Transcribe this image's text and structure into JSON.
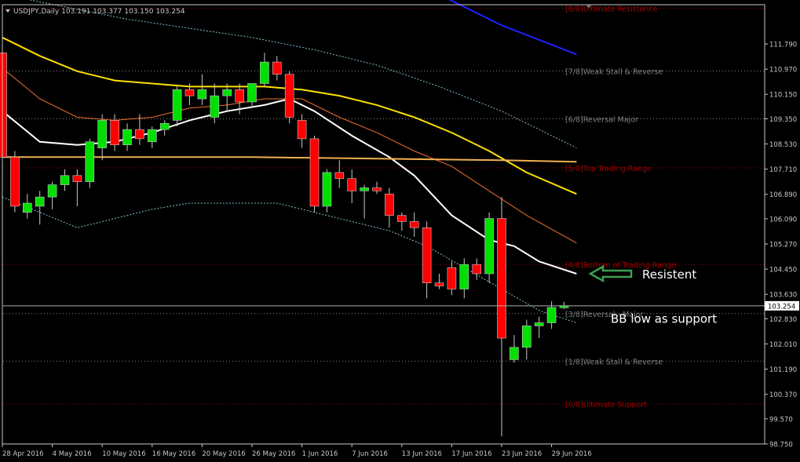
{
  "header": {
    "symbol_line": "USDJPY,Daily  103.191 103.377 103.150 103.254"
  },
  "colors": {
    "background": "#000000",
    "axis": "#c8c8c8",
    "bull": "#00e000",
    "bear": "#ff0000",
    "murrey_red": "#a00000",
    "murrey_grey": "#808080",
    "ma_white": "#ffffff",
    "ma_yellow": "#ffe000",
    "ma_orange": "#f07030",
    "ma_tan": "#f0b050",
    "bb_band": "#80c0d0",
    "ma_blue": "#2020ff",
    "arrow": "#3ca050",
    "price_tag_bg": "#ffffff",
    "price_tag_text": "#000000"
  },
  "chart_data": {
    "type": "candlestick",
    "title": "USDJPY,Daily",
    "ylim": [
      98.75,
      113.0
    ],
    "y_ticks": [
      111.79,
      110.97,
      110.15,
      109.35,
      108.53,
      107.71,
      106.89,
      106.09,
      105.27,
      104.45,
      103.63,
      102.83,
      102.01,
      101.19,
      100.37,
      99.57,
      98.75
    ],
    "x_ticks": [
      {
        "i": 0,
        "label": "28 Apr 2016"
      },
      {
        "i": 4,
        "label": "4 May 2016"
      },
      {
        "i": 8,
        "label": "10 May 2016"
      },
      {
        "i": 12,
        "label": "16 May 2016"
      },
      {
        "i": 16,
        "label": "20 May 2016"
      },
      {
        "i": 20,
        "label": "26 May 2016"
      },
      {
        "i": 24,
        "label": "1 Jun 2016"
      },
      {
        "i": 28,
        "label": "7 Jun 2016"
      },
      {
        "i": 32,
        "label": "13 Jun 2016"
      },
      {
        "i": 36,
        "label": "17 Jun 2016"
      },
      {
        "i": 40,
        "label": "23 Jun 2016"
      },
      {
        "i": 44,
        "label": "29 Jun 2016"
      }
    ],
    "candles": [
      {
        "o": 111.5,
        "h": 112.0,
        "l": 108.0,
        "c": 108.1
      },
      {
        "o": 108.1,
        "h": 108.3,
        "l": 106.3,
        "c": 106.5
      },
      {
        "o": 106.3,
        "h": 106.9,
        "l": 106.1,
        "c": 106.6
      },
      {
        "o": 106.5,
        "h": 107.0,
        "l": 105.9,
        "c": 106.8
      },
      {
        "o": 106.8,
        "h": 107.3,
        "l": 106.4,
        "c": 107.2
      },
      {
        "o": 107.2,
        "h": 107.7,
        "l": 107.0,
        "c": 107.5
      },
      {
        "o": 107.5,
        "h": 107.7,
        "l": 106.5,
        "c": 107.3
      },
      {
        "o": 107.3,
        "h": 108.7,
        "l": 107.1,
        "c": 108.6
      },
      {
        "o": 108.4,
        "h": 109.5,
        "l": 108.0,
        "c": 109.3
      },
      {
        "o": 109.3,
        "h": 109.5,
        "l": 108.3,
        "c": 108.5
      },
      {
        "o": 108.5,
        "h": 109.2,
        "l": 108.3,
        "c": 109.0
      },
      {
        "o": 109.0,
        "h": 109.5,
        "l": 108.5,
        "c": 108.7
      },
      {
        "o": 108.6,
        "h": 109.1,
        "l": 108.4,
        "c": 109.0
      },
      {
        "o": 109.0,
        "h": 109.3,
        "l": 108.8,
        "c": 109.2
      },
      {
        "o": 109.3,
        "h": 110.4,
        "l": 109.1,
        "c": 110.3
      },
      {
        "o": 110.3,
        "h": 110.5,
        "l": 109.8,
        "c": 110.1
      },
      {
        "o": 110.0,
        "h": 110.8,
        "l": 109.8,
        "c": 110.3
      },
      {
        "o": 109.4,
        "h": 110.5,
        "l": 109.2,
        "c": 110.1
      },
      {
        "o": 110.1,
        "h": 110.5,
        "l": 109.6,
        "c": 110.3
      },
      {
        "o": 110.3,
        "h": 110.5,
        "l": 109.5,
        "c": 109.9
      },
      {
        "o": 109.9,
        "h": 110.5,
        "l": 109.7,
        "c": 110.5
      },
      {
        "o": 110.5,
        "h": 111.5,
        "l": 110.4,
        "c": 111.2
      },
      {
        "o": 111.2,
        "h": 111.4,
        "l": 110.6,
        "c": 110.8
      },
      {
        "o": 110.8,
        "h": 110.9,
        "l": 109.2,
        "c": 109.4
      },
      {
        "o": 109.3,
        "h": 109.5,
        "l": 108.4,
        "c": 108.7
      },
      {
        "o": 108.7,
        "h": 108.8,
        "l": 106.3,
        "c": 106.5
      },
      {
        "o": 106.5,
        "h": 107.7,
        "l": 106.3,
        "c": 107.6
      },
      {
        "o": 107.6,
        "h": 108.0,
        "l": 107.1,
        "c": 107.4
      },
      {
        "o": 107.4,
        "h": 107.7,
        "l": 106.6,
        "c": 107.0
      },
      {
        "o": 107.0,
        "h": 107.2,
        "l": 106.1,
        "c": 107.1
      },
      {
        "o": 107.1,
        "h": 107.3,
        "l": 106.9,
        "c": 107.0
      },
      {
        "o": 106.9,
        "h": 107.1,
        "l": 105.8,
        "c": 106.2
      },
      {
        "o": 106.2,
        "h": 106.3,
        "l": 105.7,
        "c": 106.0
      },
      {
        "o": 106.0,
        "h": 106.3,
        "l": 105.5,
        "c": 105.8
      },
      {
        "o": 105.8,
        "h": 106.0,
        "l": 103.5,
        "c": 104.0
      },
      {
        "o": 104.0,
        "h": 104.3,
        "l": 103.8,
        "c": 103.9
      },
      {
        "o": 104.5,
        "h": 104.7,
        "l": 103.6,
        "c": 103.8
      },
      {
        "o": 103.8,
        "h": 104.8,
        "l": 103.5,
        "c": 104.6
      },
      {
        "o": 104.6,
        "h": 104.8,
        "l": 104.1,
        "c": 104.3
      },
      {
        "o": 104.3,
        "h": 106.3,
        "l": 104.0,
        "c": 106.1
      },
      {
        "o": 106.1,
        "h": 106.8,
        "l": 99.0,
        "c": 102.2
      },
      {
        "o": 101.5,
        "h": 102.3,
        "l": 101.4,
        "c": 101.9
      },
      {
        "o": 101.9,
        "h": 102.8,
        "l": 101.5,
        "c": 102.6
      },
      {
        "o": 102.6,
        "h": 102.9,
        "l": 102.2,
        "c": 102.7
      },
      {
        "o": 102.7,
        "h": 103.4,
        "l": 102.5,
        "c": 103.2
      },
      {
        "o": 103.19,
        "h": 103.377,
        "l": 103.15,
        "c": 103.254
      }
    ],
    "murrey_levels": [
      {
        "label": "[8/8]Ultimate Resistance",
        "value": 112.95,
        "tone": "red"
      },
      {
        "label": "[7/8]Weak Stall & Reverse",
        "value": 110.91,
        "tone": "grey"
      },
      {
        "label": "[6/8]Reversal Major",
        "value": 109.35,
        "tone": "grey"
      },
      {
        "label": "[5/8]Top Trading Range",
        "value": 107.75,
        "tone": "red"
      },
      {
        "label": "[4/8]Bottom of Trading Range",
        "value": 104.6,
        "tone": "red"
      },
      {
        "label": "[3/8]Reversal - Major",
        "value": 103.0,
        "tone": "grey"
      },
      {
        "label": "[1/8]Weak Stall & Reverse",
        "value": 101.45,
        "tone": "grey"
      },
      {
        "label": "[0/8]Ultimate Support",
        "value": 100.05,
        "tone": "red"
      }
    ],
    "current_price": 103.254,
    "annotations": [
      {
        "text": "Resistent"
      },
      {
        "text": "BB low as support"
      }
    ],
    "series": [
      {
        "key": "bb_upper",
        "style": "dashed",
        "color_key": "bb_band",
        "points": [
          [
            0,
            113.4
          ],
          [
            5,
            113.0
          ],
          [
            10,
            112.6
          ],
          [
            15,
            112.3
          ],
          [
            20,
            112.0
          ],
          [
            25,
            111.6
          ],
          [
            30,
            111.1
          ],
          [
            35,
            110.4
          ],
          [
            40,
            109.6
          ],
          [
            43,
            109.0
          ],
          [
            46,
            108.4
          ]
        ]
      },
      {
        "key": "bb_lower",
        "style": "dashed",
        "color_key": "bb_band",
        "points": [
          [
            0,
            106.8
          ],
          [
            3,
            106.3
          ],
          [
            6,
            105.8
          ],
          [
            9,
            106.1
          ],
          [
            12,
            106.4
          ],
          [
            15,
            106.6
          ],
          [
            18,
            106.6
          ],
          [
            22,
            106.6
          ],
          [
            25,
            106.3
          ],
          [
            28,
            106.0
          ],
          [
            31,
            105.7
          ],
          [
            34,
            105.2
          ],
          [
            37,
            104.5
          ],
          [
            40,
            103.8
          ],
          [
            43,
            103.1
          ],
          [
            46,
            102.7
          ]
        ]
      },
      {
        "key": "ma_white",
        "style": "solid",
        "color_key": "ma_white",
        "points": [
          [
            0,
            109.6
          ],
          [
            3,
            108.6
          ],
          [
            6,
            108.5
          ],
          [
            9,
            108.6
          ],
          [
            12,
            108.9
          ],
          [
            15,
            109.3
          ],
          [
            18,
            109.6
          ],
          [
            21,
            109.8
          ],
          [
            23,
            110.0
          ],
          [
            25,
            109.6
          ],
          [
            28,
            108.8
          ],
          [
            31,
            108.1
          ],
          [
            33,
            107.5
          ],
          [
            36,
            106.2
          ],
          [
            39,
            105.4
          ],
          [
            41,
            105.2
          ],
          [
            43,
            104.7
          ],
          [
            46,
            104.3
          ]
        ]
      },
      {
        "key": "ma_orange",
        "style": "solid",
        "color_key": "ma_orange",
        "points": [
          [
            0,
            111.0
          ],
          [
            3,
            110.0
          ],
          [
            6,
            109.4
          ],
          [
            9,
            109.3
          ],
          [
            12,
            109.4
          ],
          [
            15,
            109.7
          ],
          [
            18,
            109.8
          ],
          [
            21,
            110.0
          ],
          [
            24,
            110.0
          ],
          [
            27,
            109.4
          ],
          [
            30,
            108.9
          ],
          [
            33,
            108.3
          ],
          [
            36,
            107.8
          ],
          [
            39,
            107.0
          ],
          [
            42,
            106.2
          ],
          [
            46,
            105.3
          ]
        ]
      },
      {
        "key": "ma_yellow",
        "style": "solid",
        "color_key": "ma_yellow",
        "points": [
          [
            0,
            112.0
          ],
          [
            3,
            111.4
          ],
          [
            6,
            110.9
          ],
          [
            9,
            110.6
          ],
          [
            12,
            110.5
          ],
          [
            15,
            110.4
          ],
          [
            18,
            110.4
          ],
          [
            21,
            110.4
          ],
          [
            24,
            110.3
          ],
          [
            27,
            110.1
          ],
          [
            30,
            109.8
          ],
          [
            33,
            109.4
          ],
          [
            36,
            108.9
          ],
          [
            39,
            108.3
          ],
          [
            42,
            107.6
          ],
          [
            46,
            106.9
          ]
        ]
      },
      {
        "key": "ma_tan",
        "style": "solid",
        "color_key": "ma_tan",
        "points": [
          [
            0,
            108.1
          ],
          [
            10,
            108.1
          ],
          [
            20,
            108.1
          ],
          [
            30,
            108.05
          ],
          [
            40,
            108.0
          ],
          [
            46,
            107.95
          ]
        ]
      },
      {
        "key": "ma_blue",
        "style": "solid",
        "color_key": "ma_blue",
        "points": [
          [
            35,
            113.4
          ],
          [
            40,
            112.4
          ],
          [
            46,
            111.45
          ]
        ]
      }
    ]
  }
}
